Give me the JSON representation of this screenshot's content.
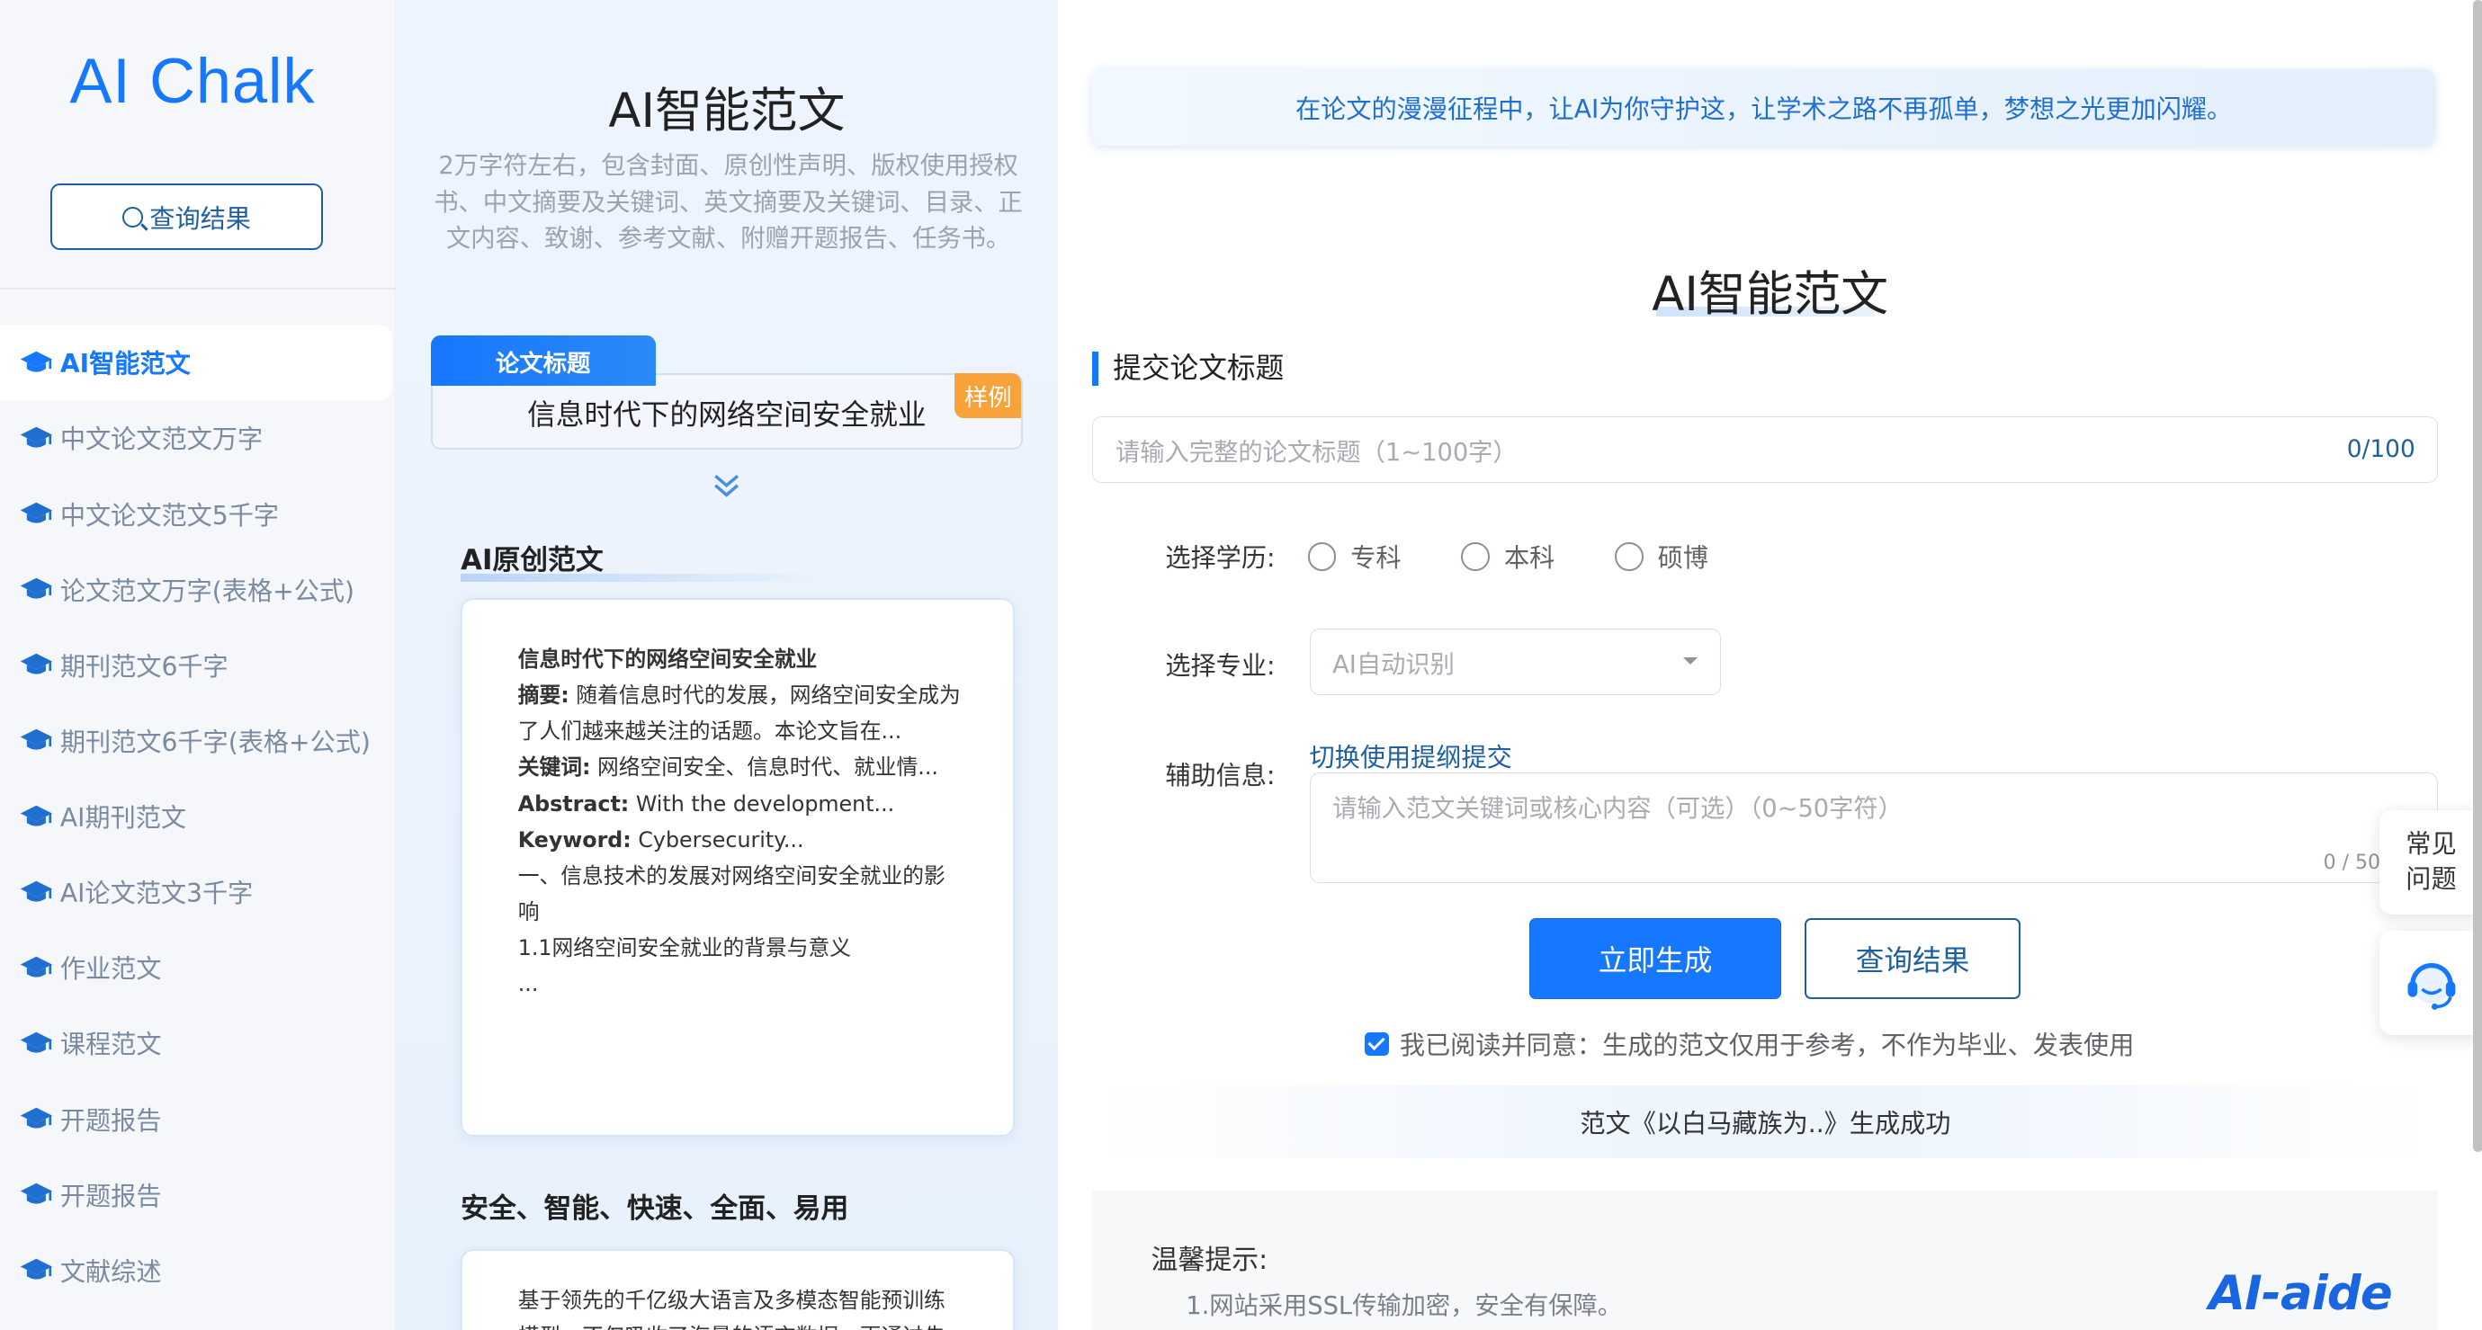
{
  "sidebar": {
    "logo": "AI Chalk",
    "query_button": "查询结果",
    "items": [
      {
        "label": "AI智能范文",
        "active": true
      },
      {
        "label": "中文论文范文万字"
      },
      {
        "label": "中文论文范文5千字"
      },
      {
        "label": "论文范文万字(表格+公式)"
      },
      {
        "label": "期刊范文6千字"
      },
      {
        "label": "期刊范文6千字(表格+公式)"
      },
      {
        "label": "AI期刊范文"
      },
      {
        "label": "AI论文范文3千字"
      },
      {
        "label": "作业范文"
      },
      {
        "label": "课程范文"
      },
      {
        "label": "开题报告"
      },
      {
        "label": "开题报告"
      },
      {
        "label": "文献综述"
      }
    ]
  },
  "intro": {
    "title": "AI智能范文",
    "description": "2万字符左右，包含封面、原创性声明、版权使用授权书、中文摘要及关键词、英文摘要及关键词、目录、正文内容、致谢、参考文献、附赠开题报告、任务书。",
    "topic_tag": "论文标题",
    "sample_badge": "样例",
    "topic_text": "信息时代下的网络空间安全就业",
    "section1_title": "AI原创范文",
    "sample": {
      "title": "信息时代下的网络空间安全就业",
      "abstract_label": "摘要:",
      "abstract_text": " 随着信息时代的发展，网络空间安全成为了人们越来越关注的话题。本论文旨在...",
      "keywords_label": "关键词:",
      "keywords_text": " 网络空间安全、信息时代、就业情...",
      "abstract_en_label": "Abstract:",
      "abstract_en_text": " With the development...",
      "keyword_en_label": "Keyword:",
      "keyword_en_text": " Cybersecurity...",
      "heading1": "一、信息技术的发展对网络空间安全就业的影响",
      "heading2": "1.1网络空间安全就业的背景与意义",
      "ellipsis": "..."
    },
    "section2_title": "安全、智能、快速、全面、易用",
    "card2_text": "基于领先的千亿级大语言及多模态智能预训练模型，不仅吸收了海量的语言数据，更通过先"
  },
  "main": {
    "banner": "在论文的漫漫征程中，让AI为你守护这，让学术之路不再孤单，梦想之光更加闪耀。",
    "title": "AI智能范文",
    "subtitle": "提交论文标题",
    "title_input": {
      "placeholder": "请输入完整的论文标题（1~100字）",
      "counter": "0/100"
    },
    "education_label": "选择学历:",
    "education_options": [
      "专科",
      "本科",
      "硕博"
    ],
    "major_label": "选择专业:",
    "major_value": "AI自动识别",
    "aux_label": "辅助信息:",
    "switch_link": "切换使用提纲提交",
    "aux_placeholder": "请输入范文关键词或核心内容（可选）（0~50字符）",
    "aux_counter": "0 / 50",
    "generate_button": "立即生成",
    "query_button": "查询结果",
    "agree_text": "我已阅读并同意：生成的范文仅用于参考，不作为毕业、发表使用",
    "agree_checked": true,
    "success_text": "范文《以白马藏族为..》生成成功",
    "tips_title": "温馨提示:",
    "tips_1": "1.网站采用SSL传输加密，安全有保障。",
    "brand": "AI-aide"
  },
  "floating": {
    "faq_line1": "常见",
    "faq_line2": "问题"
  },
  "colors": {
    "accent": "#1677ff",
    "link": "#1f5fa0",
    "badge": "#f7a23b"
  }
}
